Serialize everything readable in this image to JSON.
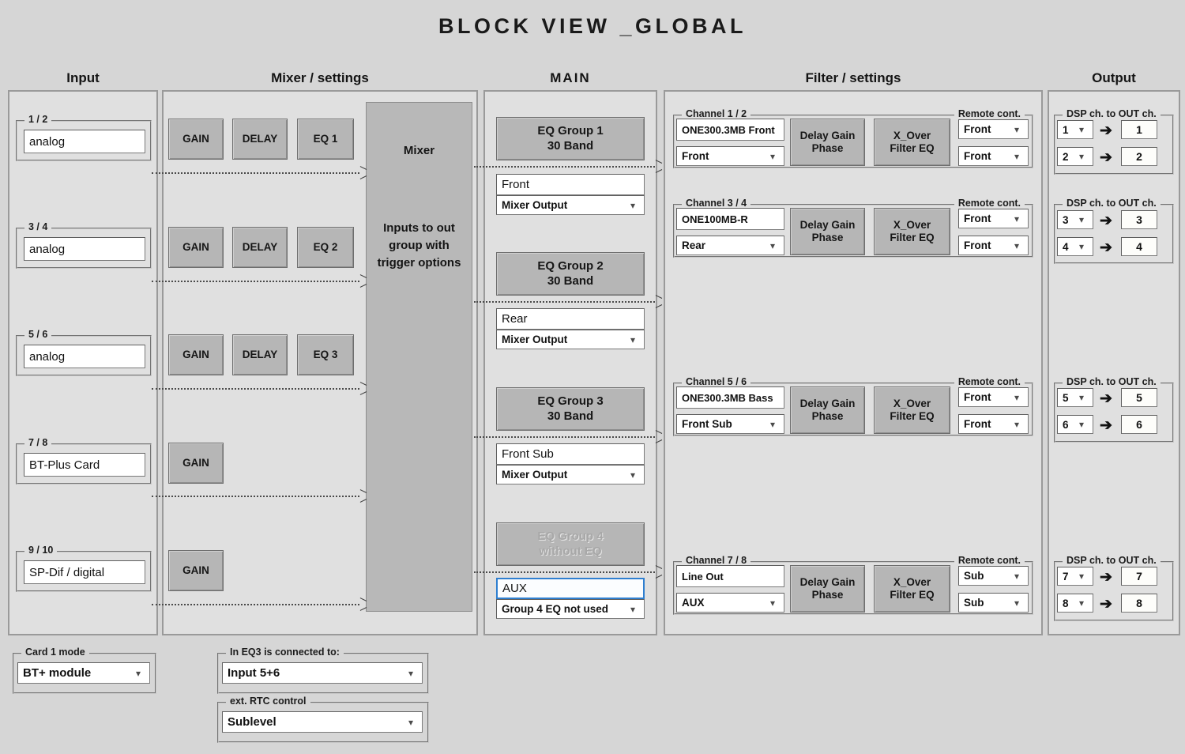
{
  "title": "BLOCK VIEW _GLOBAL",
  "columns": {
    "input": "Input",
    "mixer": "Mixer / settings",
    "main": "MAIN",
    "filter": "Filter / settings",
    "output": "Output"
  },
  "input": {
    "channels": [
      {
        "legend": "1 / 2",
        "value": "analog"
      },
      {
        "legend": "3 / 4",
        "value": "analog"
      },
      {
        "legend": "5 / 6",
        "value": "analog"
      },
      {
        "legend": "7 / 8",
        "value": "BT-Plus Card"
      },
      {
        "legend": "9 / 10",
        "value": "SP-Dif / digital"
      }
    ]
  },
  "mixer": {
    "rows": [
      {
        "gain": "GAIN",
        "delay": "DELAY",
        "eq": "EQ 1"
      },
      {
        "gain": "GAIN",
        "delay": "DELAY",
        "eq": "EQ 2"
      },
      {
        "gain": "GAIN",
        "delay": "DELAY",
        "eq": "EQ 3"
      },
      {
        "gain": "GAIN"
      },
      {
        "gain": "GAIN"
      }
    ],
    "block": {
      "title": "Mixer",
      "description": "Inputs to out group with trigger options"
    }
  },
  "main": {
    "groups": [
      {
        "button_line1": "EQ Group 1",
        "button_line2": "30 Band",
        "name": "Front",
        "source": "Mixer Output",
        "disabled": false,
        "focused": false
      },
      {
        "button_line1": "EQ Group 2",
        "button_line2": "30 Band",
        "name": "Rear",
        "source": "Mixer Output",
        "disabled": false,
        "focused": false
      },
      {
        "button_line1": "EQ Group 3",
        "button_line2": "30 Band",
        "name": "Front Sub",
        "source": "Mixer Output",
        "disabled": false,
        "focused": false
      },
      {
        "button_line1": "EQ Group 4",
        "button_line2": "without EQ",
        "name": "AUX",
        "source": "Group 4 EQ not used",
        "disabled": true,
        "focused": true
      }
    ]
  },
  "filter": {
    "remote_legend": "Remote cont.",
    "channels": [
      {
        "legend": "Channel 1 / 2",
        "speaker": "ONE300.3MB Front",
        "zone": "Front",
        "btn1_line1": "Delay Gain",
        "btn1_line2": "Phase",
        "btn2_line1": "X_Over",
        "btn2_line2": "Filter EQ",
        "remote1": "Front",
        "remote2": "Front"
      },
      {
        "legend": "Channel 3 / 4",
        "speaker": "ONE100MB-R",
        "zone": "Rear",
        "btn1_line1": "Delay Gain",
        "btn1_line2": "Phase",
        "btn2_line1": "X_Over",
        "btn2_line2": "Filter EQ",
        "remote1": "Front",
        "remote2": "Front"
      },
      {
        "legend": "Channel 5 / 6",
        "speaker": "ONE300.3MB Bass",
        "zone": "Front Sub",
        "btn1_line1": "Delay Gain",
        "btn1_line2": "Phase",
        "btn2_line1": "X_Over",
        "btn2_line2": "Filter EQ",
        "remote1": "Front",
        "remote2": "Front"
      },
      {
        "legend": "Channel 7 / 8",
        "speaker": "Line Out",
        "zone": "AUX",
        "btn1_line1": "Delay Gain",
        "btn1_line2": "Phase",
        "btn2_line1": "X_Over",
        "btn2_line2": "Filter EQ",
        "remote1": "Sub",
        "remote2": "Sub"
      }
    ]
  },
  "output": {
    "legend": "DSP ch. to OUT ch.",
    "arrow": "➔",
    "blocks": [
      {
        "rows": [
          {
            "dsp": "1",
            "out": "1"
          },
          {
            "dsp": "2",
            "out": "2"
          }
        ]
      },
      {
        "rows": [
          {
            "dsp": "3",
            "out": "3"
          },
          {
            "dsp": "4",
            "out": "4"
          }
        ]
      },
      {
        "rows": [
          {
            "dsp": "5",
            "out": "5"
          },
          {
            "dsp": "6",
            "out": "6"
          }
        ]
      },
      {
        "rows": [
          {
            "dsp": "7",
            "out": "7"
          },
          {
            "dsp": "8",
            "out": "8"
          }
        ]
      }
    ]
  },
  "bottom": {
    "card_mode": {
      "legend": "Card 1 mode",
      "value": "BT+ module"
    },
    "eq3_connected": {
      "legend": "In EQ3 is connected to:",
      "value": "Input 5+6"
    },
    "ext_rtc": {
      "legend": "ext. RTC control",
      "value": "Sublevel"
    }
  }
}
